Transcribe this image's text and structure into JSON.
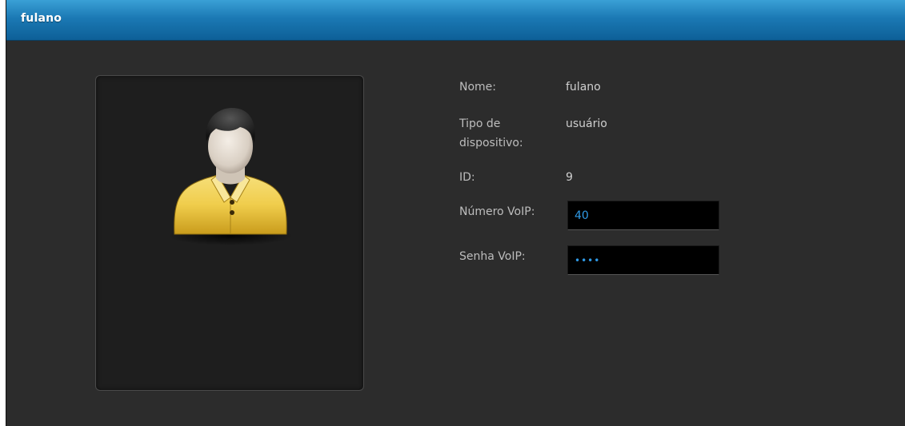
{
  "window": {
    "title": "fulano"
  },
  "avatar": {
    "icon": "user-avatar-icon"
  },
  "info": {
    "name_label": "Nome:",
    "name_value": "fulano",
    "device_type_label_line1": "Tipo de",
    "device_type_label_line2": "dispositivo:",
    "device_type_value": "usuário",
    "id_label": "ID:",
    "id_value": "9",
    "voip_number_label": "Número VoIP:",
    "voip_number_value": "40",
    "voip_password_label": "Senha VoIP:",
    "voip_password_value": "••••"
  },
  "colors": {
    "titlebar": "#1b79b4",
    "background": "#2c2c2c",
    "field_background": "#000000",
    "field_text": "#2f9ae6"
  }
}
